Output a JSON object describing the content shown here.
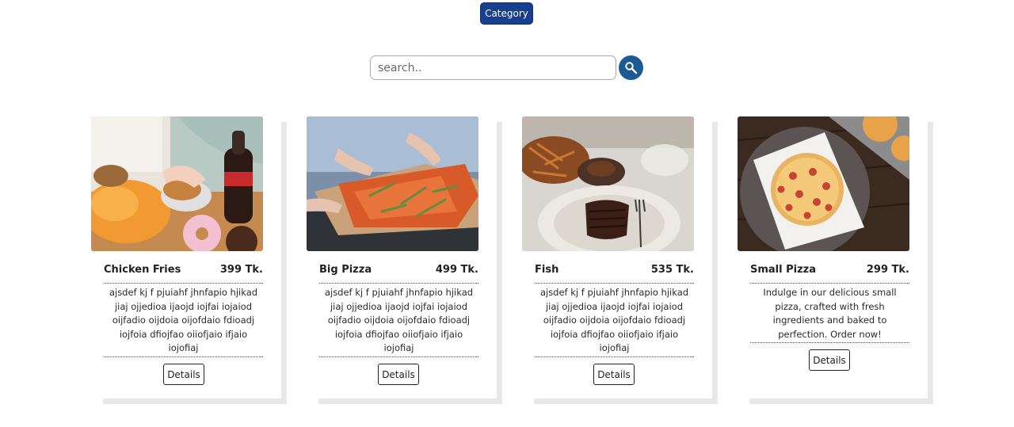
{
  "header": {
    "category_label": "Category"
  },
  "search": {
    "placeholder": "search..",
    "button_icon": "search-icon",
    "accent": "#1d5a93"
  },
  "colors": {
    "category_bg": "#163f8f",
    "divider": "#8a2846",
    "card_shadow": "#e8e8e8"
  },
  "products": [
    {
      "name": "Chicken Fries",
      "price": "399 Tk.",
      "description": "ajsdef kj f pjuiahf jhnfapio hjikad jiaj ojjedioa ijaojd iojfai iojaiod oijfadio oijdoia oijofdaio fdioadj iojfoia dfiojfao oiiofjaio ifjaio iojofiaj",
      "details_label": "Details",
      "image_alt": "chicken fries with soda and donuts"
    },
    {
      "name": "Big Pizza",
      "price": "499 Tk.",
      "description": "ajsdef kj f pjuiahf jhnfapio hjikad jiaj ojjedioa ijaojd iojfai iojaiod oijfadio oijdoia oijofdaio fdioadj iojfoia dfiojfao oiiofjaio ifjaio iojofiaj",
      "details_label": "Details",
      "image_alt": "big pizza with arugula"
    },
    {
      "name": "Fish",
      "price": "535 Tk.",
      "description": "ajsdef kj f pjuiahf jhnfapio hjikad jiaj ojjedioa ijaojd iojfai iojaiod oijfadio oijdoia oijofdaio fdioadj iojfoia dfiojfao oiiofjaio ifjaio iojofiaj",
      "details_label": "Details",
      "image_alt": "grilled fish steak with fries"
    },
    {
      "name": "Small Pizza",
      "price": "299 Tk.",
      "description": "Indulge in our delicious small pizza, crafted with fresh ingredients and baked to perfection. Order now!",
      "details_label": "Details",
      "image_alt": "small pepperoni pizza"
    }
  ]
}
